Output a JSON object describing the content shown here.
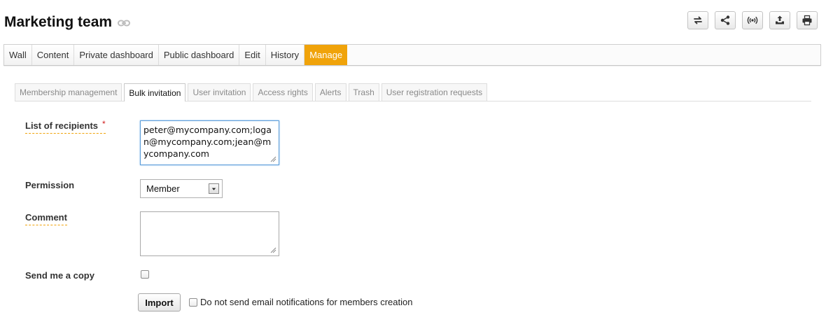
{
  "header": {
    "title": "Marketing team",
    "title_icon": "link-icon",
    "toolbar": [
      {
        "name": "swap-icon"
      },
      {
        "name": "share-icon"
      },
      {
        "name": "broadcast-icon"
      },
      {
        "name": "upload-icon"
      },
      {
        "name": "print-icon"
      }
    ]
  },
  "main_tabs": [
    {
      "label": "Wall",
      "active": false
    },
    {
      "label": "Content",
      "active": false
    },
    {
      "label": "Private dashboard",
      "active": false
    },
    {
      "label": "Public dashboard",
      "active": false
    },
    {
      "label": "Edit",
      "active": false
    },
    {
      "label": "History",
      "active": false
    },
    {
      "label": "Manage",
      "active": true
    }
  ],
  "sub_tabs": [
    {
      "label": "Membership management",
      "active": false
    },
    {
      "label": "Bulk invitation",
      "active": true
    },
    {
      "label": "User invitation",
      "active": false
    },
    {
      "label": "Access rights",
      "active": false
    },
    {
      "label": "Alerts",
      "active": false
    },
    {
      "label": "Trash",
      "active": false
    },
    {
      "label": "User registration requests",
      "active": false
    }
  ],
  "form": {
    "recipients_label": "List of recipients",
    "required_marker": "*",
    "recipients_value": "peter@mycompany.com;logan@mycompany.com;jean@mycompany.com",
    "permission_label": "Permission",
    "permission_value": "Member",
    "comment_label": "Comment",
    "comment_value": "",
    "send_copy_label": "Send me a copy",
    "send_copy_checked": false,
    "import_label": "Import",
    "no_notify_label": "Do not send email notifications for members creation",
    "no_notify_checked": false
  },
  "colors": {
    "accent": "#f0a30a",
    "required": "#d01e1e",
    "focus": "#5b9dd9"
  }
}
